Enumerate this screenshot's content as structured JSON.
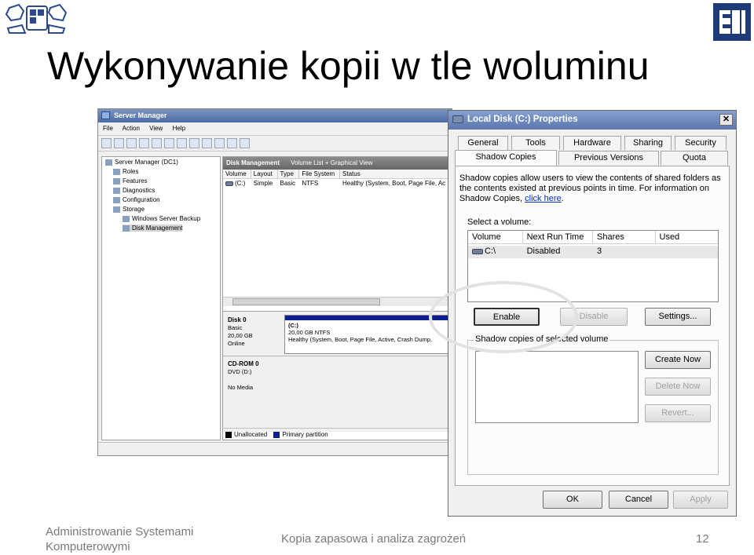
{
  "slide": {
    "title": "Wykonywanie kopii w tle woluminu",
    "footer_left": "Administrowanie Systemami Komputerowymi",
    "footer_center": "Kopia zapasowa i analiza zagrożeń",
    "page_number": "12"
  },
  "server_manager": {
    "title": "Server Manager",
    "menu": [
      "File",
      "Action",
      "View",
      "Help"
    ],
    "tree": [
      {
        "label": "Server Manager (DC1)"
      },
      {
        "label": "Roles"
      },
      {
        "label": "Features"
      },
      {
        "label": "Diagnostics"
      },
      {
        "label": "Configuration"
      },
      {
        "label": "Storage"
      },
      {
        "label": "Windows Server Backup"
      },
      {
        "label": "Disk Management"
      }
    ],
    "disk_management": {
      "header": "Disk Management",
      "subheader": "Volume List + Graphical View",
      "columns": [
        "Volume",
        "Layout",
        "Type",
        "File System",
        "Status"
      ],
      "row": [
        "(C:)",
        "Simple",
        "Basic",
        "NTFS",
        "Healthy (System, Boot, Page File, Ac"
      ]
    },
    "disk0": {
      "name": "Disk 0",
      "line1": "Basic",
      "line2": "20,00 GB",
      "line3": "Online",
      "vol_name": "(C:)",
      "vol_size": "20,00 GB NTFS",
      "vol_status": "Healthy (System, Boot, Page File, Active, Crash Dump,"
    },
    "cdrom0": {
      "name": "CD-ROM 0",
      "line1": "DVD (D:)",
      "line2": "No Media"
    },
    "legend": {
      "unallocated": "Unallocated",
      "primary": "Primary partition"
    }
  },
  "properties": {
    "title": "Local Disk (C:) Properties",
    "close": "✕",
    "tabs_row1": [
      "General",
      "Tools",
      "Hardware",
      "Sharing",
      "Security"
    ],
    "tabs_row2": [
      "Shadow Copies",
      "Previous Versions",
      "Quota"
    ],
    "description": "Shadow copies allow users to view the contents of shared folders as the contents existed at previous points in time. For information on Shadow Copies,",
    "link": "click here",
    "after_link": ".",
    "select_label": "Select a volume:",
    "columns": [
      "Volume",
      "Next Run Time",
      "Shares",
      "Used"
    ],
    "volume_row": [
      "C:\\",
      "Disabled",
      "3",
      ""
    ],
    "buttons": {
      "enable": "Enable",
      "disable": "Disable",
      "settings": "Settings...",
      "create_now": "Create Now",
      "delete_now": "Delete Now",
      "revert": "Revert...",
      "ok": "OK",
      "cancel": "Cancel",
      "apply": "Apply"
    },
    "group_label": "Shadow copies of selected volume"
  },
  "colors": {
    "title_bar": "#5a76ad",
    "primary_partition": "#0e1f8f",
    "link": "#0030c0"
  }
}
